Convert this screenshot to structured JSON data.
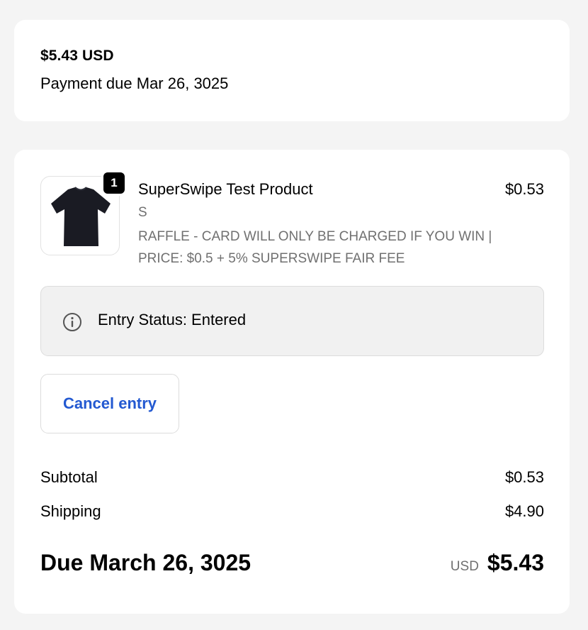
{
  "summary": {
    "amount": "$5.43 USD",
    "payment_due": "Payment due Mar 26, 3025"
  },
  "line_item": {
    "quantity": "1",
    "name": "SuperSwipe Test Product",
    "price": "$0.53",
    "variant": "S",
    "note": "RAFFLE - CARD WILL ONLY BE CHARGED IF YOU WIN | PRICE: $0.5 + 5% SUPERSWIPE FAIR FEE",
    "image_icon": "tshirt-icon"
  },
  "status": {
    "icon": "info-icon",
    "text": "Entry Status: Entered"
  },
  "actions": {
    "cancel_label": "Cancel entry"
  },
  "totals": {
    "subtotal_label": "Subtotal",
    "subtotal_value": "$0.53",
    "shipping_label": "Shipping",
    "shipping_value": "$4.90",
    "due_label": "Due March 26, 3025",
    "currency": "USD",
    "due_amount": "$5.43"
  },
  "colors": {
    "link_blue": "#2359d1",
    "muted_text": "#707070",
    "page_bg": "#f4f4f4"
  }
}
